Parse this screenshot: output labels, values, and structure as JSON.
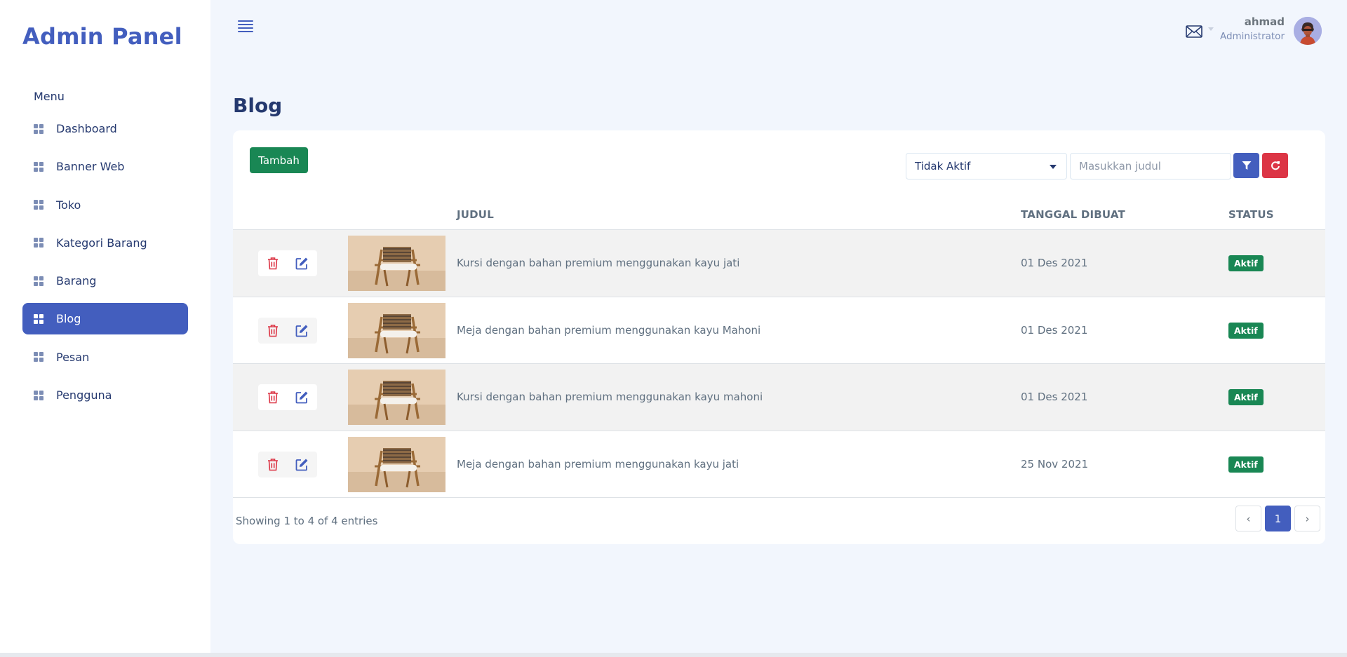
{
  "app": {
    "title": "Admin Panel"
  },
  "sidebar": {
    "menu_title": "Menu",
    "items": [
      {
        "label": "Dashboard",
        "active": false
      },
      {
        "label": "Banner Web",
        "active": false
      },
      {
        "label": "Toko",
        "active": false
      },
      {
        "label": "Kategori Barang",
        "active": false
      },
      {
        "label": "Barang",
        "active": false
      },
      {
        "label": "Blog",
        "active": true
      },
      {
        "label": "Pesan",
        "active": false
      },
      {
        "label": "Pengguna",
        "active": false
      }
    ]
  },
  "header": {
    "user": {
      "name": "ahmad",
      "role": "Administrator"
    },
    "icons": [
      "menu-icon",
      "mail-icon",
      "avatar"
    ]
  },
  "page": {
    "title": "Blog"
  },
  "toolbar": {
    "add_label": "Tambah",
    "status_select": "Tidak Aktif",
    "search_placeholder": "Masukkan judul",
    "filter_icon": "filter-icon",
    "reset_icon": "refresh-icon"
  },
  "table": {
    "columns": [
      "JUDUL",
      "TANGGAL DIBUAT",
      "STATUS"
    ],
    "rows": [
      {
        "title": "Kursi dengan bahan premium menggunakan kayu jati",
        "date": "01 Des 2021",
        "status": "Aktif"
      },
      {
        "title": "Meja dengan bahan premium menggunakan kayu Mahoni",
        "date": "01 Des 2021",
        "status": "Aktif"
      },
      {
        "title": "Kursi dengan bahan premium menggunakan kayu mahoni",
        "date": "01 Des 2021",
        "status": "Aktif"
      },
      {
        "title": "Meja dengan bahan premium menggunakan kayu jati",
        "date": "25 Nov 2021",
        "status": "Aktif"
      }
    ]
  },
  "pagination": {
    "info": "Showing 1 to 4 of 4 entries",
    "current_page": "1",
    "prev": "‹",
    "next": "›"
  },
  "colors": {
    "primary": "#435ebe",
    "success": "#198754",
    "danger": "#dc3545",
    "text": "#25396f",
    "muted": "#607080"
  }
}
